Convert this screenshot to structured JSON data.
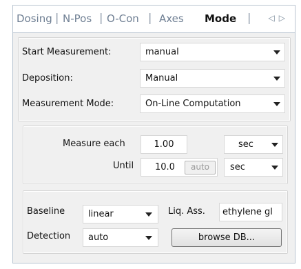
{
  "tabs": [
    {
      "label": "Dosing",
      "active": false
    },
    {
      "label": "N-Pos",
      "active": false
    },
    {
      "label": "O-Con",
      "active": false
    },
    {
      "label": "Axes",
      "active": false
    },
    {
      "label": "Mode",
      "active": true
    }
  ],
  "tab_scroll": {
    "left_icon": "chevron-left-icon",
    "right_icon": "chevron-right-icon",
    "glyphs": "◁▷"
  },
  "top_fields": {
    "start_measurement": {
      "label": "Start Measurement:",
      "value": "manual"
    },
    "deposition": {
      "label": "Deposition:",
      "value": "Manual"
    },
    "measurement_mode": {
      "label": "Measurement Mode:",
      "value": "On-Line Computation"
    }
  },
  "timing": {
    "measure_each": {
      "label": "Measure each",
      "value": "1.00",
      "unit": "sec"
    },
    "until": {
      "label": "Until",
      "value": "10.0",
      "auto_label": "auto",
      "unit": "sec"
    }
  },
  "baseline_group": {
    "baseline": {
      "label": "Baseline",
      "value": "linear"
    },
    "liq_ass": {
      "label": "Liq. Ass.",
      "value": "ethylene gl"
    },
    "detection": {
      "label": "Detection",
      "value": "auto"
    },
    "browse_label": "browse DB..."
  }
}
